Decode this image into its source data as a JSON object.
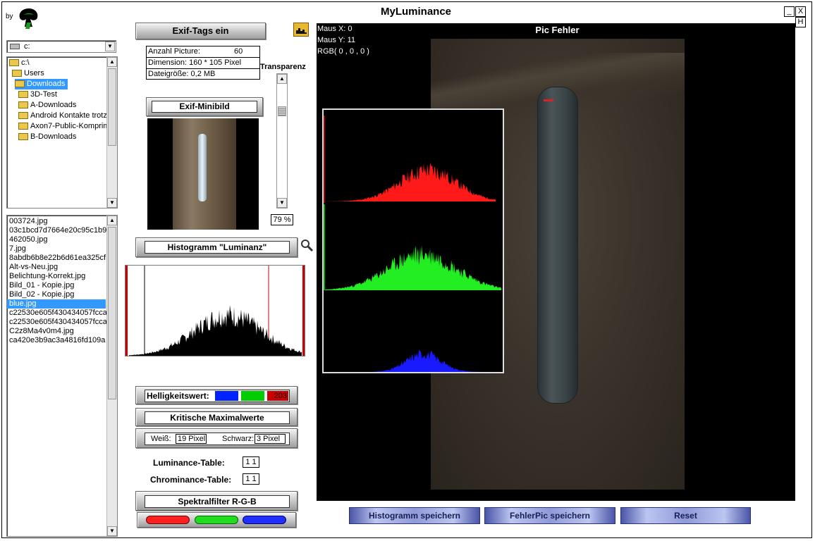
{
  "window": {
    "title": "MyLuminance",
    "by_label": "by",
    "minimize": "_",
    "close": "X",
    "help": "H"
  },
  "drive": {
    "value": "c:"
  },
  "tree": [
    {
      "label": "c:\\"
    },
    {
      "label": "Users"
    },
    {
      "label": "Downloads"
    },
    {
      "label": "3D-Test"
    },
    {
      "label": "A-Downloads"
    },
    {
      "label": "Android Kontakte trotz"
    },
    {
      "label": "Axon7-Public-Komprimi"
    },
    {
      "label": "B-Downloads"
    }
  ],
  "files": [
    "003724.jpg",
    "03c1bcd7d7664e20c95c1b9",
    "462050.jpg",
    "7.jpg",
    "8abdb6b8e22b6d61ea325cf",
    "Alt-vs-Neu.jpg",
    "Belichtung-Korrekt.jpg",
    "Bild_01 - Kopie.jpg",
    "Bild_02 - Kopie.jpg",
    "blue.jpg",
    "c22530e605f430434057fcca",
    "c22530e605f430434057fcca",
    "C2z8Ma4v0m4.jpg",
    "ca420e3b9ac3a4816fd109a"
  ],
  "exif": {
    "button": "Exif-Tags ein",
    "count_label": "Anzahl Picture:",
    "count_value": "60",
    "dimension": "Dimension: 160 * 105 Pixel",
    "filesize": "Dateigröße: 0,2 MB",
    "mini_button": "Exif-Minibild"
  },
  "transparency": {
    "label": "Transparenz",
    "value": "79 %",
    "level": 0.79
  },
  "histogram": {
    "button": "Histogramm \"Luminanz\""
  },
  "brightness": {
    "label": "Helligkeitswert:",
    "value": "203",
    "colors": [
      "#0022ff",
      "#00cc00",
      "#cc0000"
    ]
  },
  "critical": {
    "button": "Kritische Maximalwerte",
    "white_label": "Weiß:",
    "white_value": "19 Pixel",
    "black_label": "Schwarz:",
    "black_value": "3 Pixel"
  },
  "tables": {
    "lum_label": "Luminance-Table:",
    "lum_value": "1 1",
    "chrom_label": "Chrominance-Table:",
    "chrom_value": "1 1"
  },
  "spectral": {
    "button": "Spektralfilter R-G-B",
    "colors": [
      "#ff2020",
      "#20dd20",
      "#2030ff"
    ]
  },
  "viewer": {
    "title": "Pic Fehler",
    "mouse_x": "Maus X:   0",
    "mouse_y": "Maus Y:   11",
    "rgb": "RGB( 0 , 0 , 0 )"
  },
  "bottom_buttons": {
    "save_hist": "Histogramm speichern",
    "save_err": "FehlerPic speichern",
    "reset": "Reset"
  }
}
